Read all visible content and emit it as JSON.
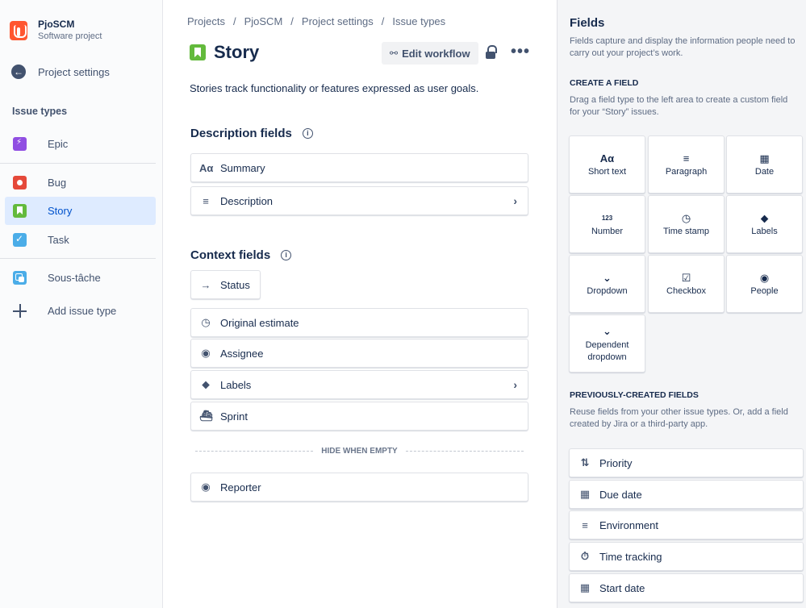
{
  "project": {
    "name": "PjoSCM",
    "type": "Software project"
  },
  "sidebar": {
    "back_label": "Project settings",
    "section_title": "Issue types",
    "items": [
      {
        "label": "Epic",
        "icon": "epic-icon"
      },
      {
        "label": "Bug",
        "icon": "bug-icon"
      },
      {
        "label": "Story",
        "icon": "story-icon",
        "active": true
      },
      {
        "label": "Task",
        "icon": "task-icon"
      },
      {
        "label": "Sous-tâche",
        "icon": "subtask-icon"
      }
    ],
    "add_label": "Add issue type"
  },
  "breadcrumbs": [
    "Projects",
    "PjoSCM",
    "Project settings",
    "Issue types"
  ],
  "issue": {
    "title": "Story",
    "description": "Stories track functionality or features expressed as user goals.",
    "edit_workflow_label": "Edit workflow"
  },
  "description_fields": {
    "heading": "Description fields",
    "items": [
      {
        "label": "Summary",
        "icon": "text-icon"
      },
      {
        "label": "Description",
        "icon": "paragraph-icon",
        "expandable": true
      }
    ]
  },
  "context_fields": {
    "heading": "Context fields",
    "status_label": "Status",
    "items": [
      {
        "label": "Original estimate",
        "icon": "clock-icon"
      },
      {
        "label": "Assignee",
        "icon": "person-icon"
      },
      {
        "label": "Labels",
        "icon": "tag-icon",
        "expandable": true
      },
      {
        "label": "Sprint",
        "icon": "sprint-icon"
      }
    ],
    "hide_when_empty_label": "HIDE WHEN EMPTY",
    "hidden_items": [
      {
        "label": "Reporter",
        "icon": "person-icon"
      }
    ]
  },
  "fields_panel": {
    "title": "Fields",
    "description": "Fields capture and display the information people need to carry out your project’s work.",
    "create_heading": "CREATE A FIELD",
    "create_description": "Drag a field type to the left area to create a custom field for your “Story” issues.",
    "types": [
      {
        "label": "Short text",
        "icon": "Aα"
      },
      {
        "label": "Paragraph",
        "icon": "≡"
      },
      {
        "label": "Date",
        "icon": "▦"
      },
      {
        "label": "Number",
        "icon": "123"
      },
      {
        "label": "Time stamp",
        "icon": "◷"
      },
      {
        "label": "Labels",
        "icon": "⬥"
      },
      {
        "label": "Dropdown",
        "icon": "⌄"
      },
      {
        "label": "Checkbox",
        "icon": "☑"
      },
      {
        "label": "People",
        "icon": "◉"
      },
      {
        "label": "Dependent dropdown",
        "icon": "⌄"
      }
    ],
    "previous_heading": "PREVIOUSLY-CREATED FIELDS",
    "previous_description": "Reuse fields from your other issue types. Or, add a field created by Jira or a third-party app.",
    "previous_fields": [
      {
        "label": "Priority",
        "icon": "⇅"
      },
      {
        "label": "Due date",
        "icon": "▦"
      },
      {
        "label": "Environment",
        "icon": "≡"
      },
      {
        "label": "Time tracking",
        "icon": "⏱"
      },
      {
        "label": "Start date",
        "icon": "▦"
      }
    ]
  }
}
